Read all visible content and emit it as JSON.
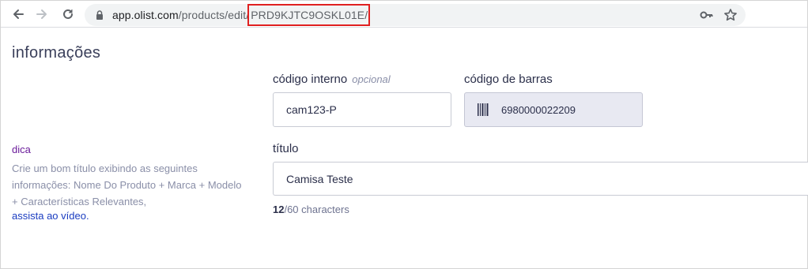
{
  "browser": {
    "url_host": "app.olist.com",
    "url_path": "/products/edit/",
    "url_highlight": "PRD9KJTC9OSKL01E/"
  },
  "section": {
    "title": "informações"
  },
  "form": {
    "internal_code": {
      "label": "código interno",
      "optional": "opcional",
      "value": "cam123-P"
    },
    "barcode": {
      "label": "código de barras",
      "value": "6980000022209"
    },
    "title": {
      "label": "título",
      "value": "Camisa Teste"
    },
    "char_count": {
      "used": "12",
      "rest": "/60 characters"
    }
  },
  "tip": {
    "title": "dica",
    "text": "Crie um bom título exibindo as seguintes informações: Nome Do Produto + Marca + Modelo + Características Relevantes,",
    "link": "assista ao vídeo."
  },
  "colors": {
    "accent_purple": "#6a1b9a",
    "link_blue": "#1a3cc0",
    "highlight_red": "#e02020"
  }
}
